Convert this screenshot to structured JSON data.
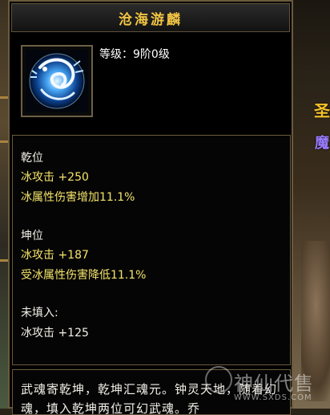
{
  "item": {
    "name": "沧海游麟",
    "level_text": "等级：9阶0级",
    "icon": "ice-dragon-orb-icon"
  },
  "slots": [
    {
      "title": "乾位",
      "lines": [
        "冰攻击 +250",
        "冰属性伤害增加11.1%"
      ]
    },
    {
      "title": "坤位",
      "lines": [
        "冰攻击 +187",
        "受冰属性伤害降低11.1%"
      ]
    },
    {
      "title": "未填入:",
      "lines": [
        "冰攻击 +125"
      ]
    }
  ],
  "description": "武魂寄乾坤，乾坤汇魂元。钟灵天地，随着幻魂，填入乾坤两位可幻武魂。乔",
  "background": {
    "side_text_gold": "圣",
    "side_text_purple": "魔"
  },
  "watermark": {
    "text": "神仙代售",
    "url": "WWW.SXDS.COM"
  },
  "colors": {
    "title": "#f1c543",
    "stat_yellow": "#f5e56a",
    "text_white": "#f2f0e8",
    "border": "#6a5a3c"
  }
}
